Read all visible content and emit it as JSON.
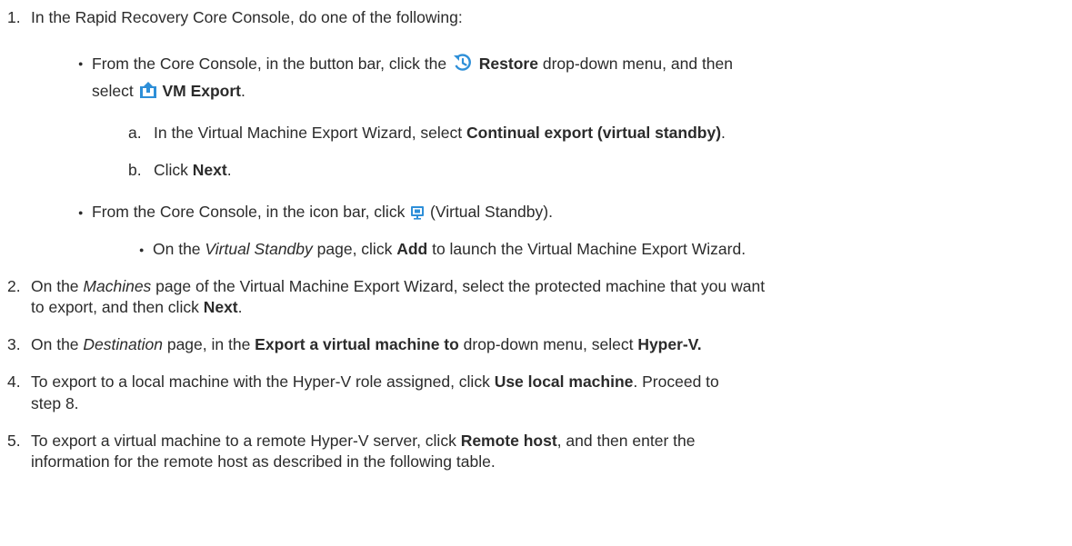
{
  "steps": [
    {
      "num": "1.",
      "text": "In the Rapid Recovery Core Console, do one of the following:"
    },
    {
      "num": "2.",
      "line1_pre": "On the ",
      "line1_em": "Machines",
      "line1_post": " page of the Virtual Machine Export Wizard, select the protected machine that you want",
      "line2_pre": "to export, and then click ",
      "line2_bold": "Next",
      "line2_post": "."
    },
    {
      "num": "3.",
      "pre": "On the ",
      "em": "Destination",
      "mid": " page, in the ",
      "bold1": "Export a virtual machine to",
      "mid2": " drop-down menu, select ",
      "bold2": "Hyper-V."
    },
    {
      "num": "4.",
      "line1_pre": "To export to a local machine with the Hyper-V role assigned, click ",
      "line1_bold": "Use local machine",
      "line1_post": ". Proceed to",
      "line2": "step 8."
    },
    {
      "num": "5.",
      "line1_pre": "To export a virtual machine to a remote Hyper-V server, click ",
      "line1_bold": "Remote host",
      "line1_post": ", and then enter the",
      "line2": "information for the remote host as described in the following table."
    }
  ],
  "bullet1": {
    "pre": "From the Core Console, in the button bar, click the ",
    "icon": "restore-icon",
    "bold": "Restore",
    "post": " drop-down menu, and then",
    "line2_pre": "select ",
    "icon2": "vm-export-icon",
    "line2_bold": "VM Export",
    "line2_post": "."
  },
  "substeps": [
    {
      "letter": "a.",
      "pre": "In the Virtual Machine Export Wizard, select ",
      "bold": "Continual export (virtual standby)",
      "post": "."
    },
    {
      "letter": "b.",
      "pre": "Click ",
      "bold": "Next",
      "post": "."
    }
  ],
  "bullet2": {
    "pre": "From the Core Console, in the icon bar, click ",
    "icon": "virtual-standby-icon",
    "post": " (Virtual Standby)."
  },
  "subbullet": {
    "pre": "On the ",
    "em": "Virtual Standby",
    "mid": " page, click ",
    "bold": "Add",
    "post": " to launch the Virtual Machine Export Wizard."
  },
  "colors": {
    "text": "#2b2b2b",
    "icon_blue": "#2e8fd8"
  }
}
